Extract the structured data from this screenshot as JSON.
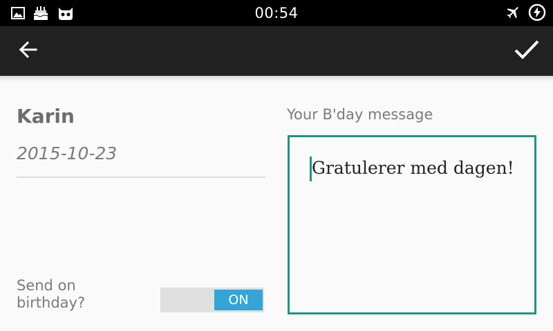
{
  "status_bar": {
    "time": "00:54",
    "left_icons": [
      "image-icon",
      "cake-icon",
      "cyanogen-icon"
    ],
    "right_icons": [
      "airplane-mode-icon",
      "battery-charging-icon"
    ]
  },
  "action_bar": {
    "left_icon": "back-arrow-icon",
    "right_icon": "checkmark-icon"
  },
  "contact": {
    "name": "Karin",
    "date": "2015-10-23"
  },
  "send_toggle": {
    "label": "Send on birthday?",
    "state": "ON"
  },
  "message": {
    "label": "Your B'day message",
    "value": "Gratulerer med dagen!"
  },
  "colors": {
    "accent": "#1a9585",
    "toggle_on": "#33a5d6",
    "action_bar": "#212121"
  }
}
